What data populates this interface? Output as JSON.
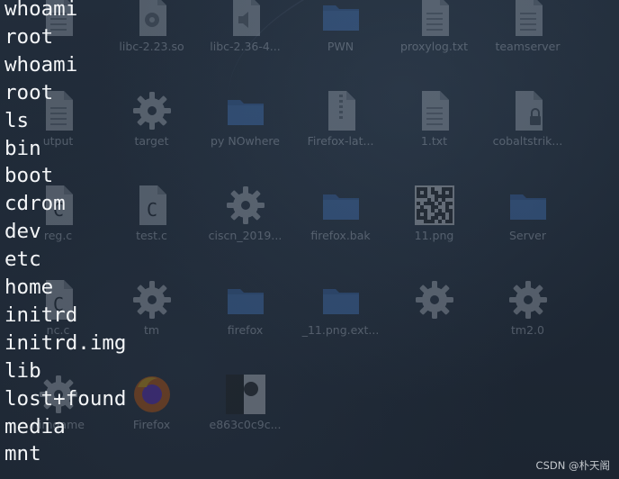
{
  "desktop": {
    "icons": [
      {
        "label": "",
        "type": "file"
      },
      {
        "label": "libc-2.23.so",
        "type": "gear-file"
      },
      {
        "label": "libc-2.36-4...",
        "type": "sound-file"
      },
      {
        "label": "PWN",
        "type": "folder"
      },
      {
        "label": "proxylog.txt",
        "type": "text-file"
      },
      {
        "label": "teamserver",
        "type": "script-file"
      },
      {
        "label": "utput",
        "type": "file"
      },
      {
        "label": "target",
        "type": "gear"
      },
      {
        "label": "py NOwhere",
        "type": "folder"
      },
      {
        "label": "Firefox-lat...",
        "type": "archive"
      },
      {
        "label": "1.txt",
        "type": "text-file"
      },
      {
        "label": "cobaltstrik...",
        "type": "locked-file"
      },
      {
        "label": "reg.c",
        "type": "c-file"
      },
      {
        "label": "test.c",
        "type": "c-file"
      },
      {
        "label": "ciscn_2019...",
        "type": "gear"
      },
      {
        "label": "firefox.bak",
        "type": "folder"
      },
      {
        "label": "11.png",
        "type": "qr-image"
      },
      {
        "label": "Server",
        "type": "folder"
      },
      {
        "label": "nc.c",
        "type": "c-file"
      },
      {
        "label": "tm",
        "type": "gear"
      },
      {
        "label": "firefox",
        "type": "folder"
      },
      {
        "label": "_11.png.ext...",
        "type": "folder"
      },
      {
        "label": "",
        "type": "gear"
      },
      {
        "label": "tm2.0",
        "type": "gear"
      },
      {
        "label": "nimgame",
        "type": "gear"
      },
      {
        "label": "Firefox",
        "type": "firefox"
      },
      {
        "label": "e863c0c9c...",
        "type": "image"
      }
    ]
  },
  "terminal": {
    "lines": [
      "whoami",
      "root",
      "whoami",
      "root",
      "ls",
      "bin",
      "boot",
      "cdrom",
      "dev",
      "etc",
      "home",
      "initrd",
      "initrd.img",
      "lib",
      "lost+found",
      "media",
      "mnt"
    ]
  },
  "watermark": "CSDN @朴天阁",
  "colors": {
    "background": "#1f2a38",
    "terminal_text": "#f4f6f8",
    "folder": "#3d72c0",
    "firefox_orange": "#e66000"
  }
}
